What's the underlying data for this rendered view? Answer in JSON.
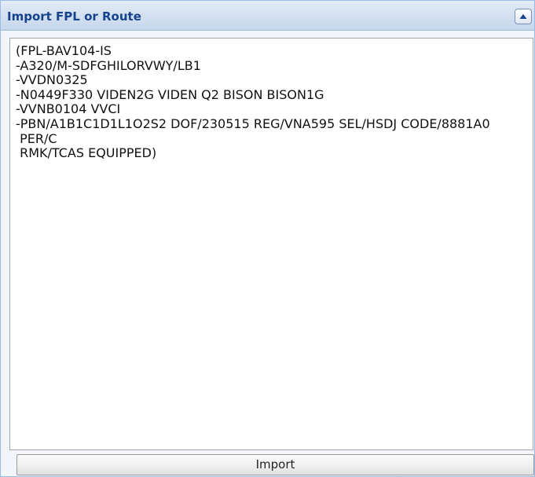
{
  "panel": {
    "title": "Import FPL or Route",
    "collapse_icon": "chevron-up-icon"
  },
  "route_input": {
    "value": "(FPL-BAV104-IS\n-A320/M-SDFGHILORVWY/LB1\n-VVDN0325\n-N0449F330 VIDEN2G VIDEN Q2 BISON BISON1G\n-VVNB0104 VVCI\n-PBN/A1B1C1D1L1O2S2 DOF/230515 REG/VNA595 SEL/HSDJ CODE/8881A0\n PER/C\n RMK/TCAS EQUIPPED)"
  },
  "actions": {
    "import_label": "Import"
  },
  "colors": {
    "title_text": "#15428b",
    "header_border": "#99bbe8",
    "panel_background": "#f2f5fa"
  }
}
